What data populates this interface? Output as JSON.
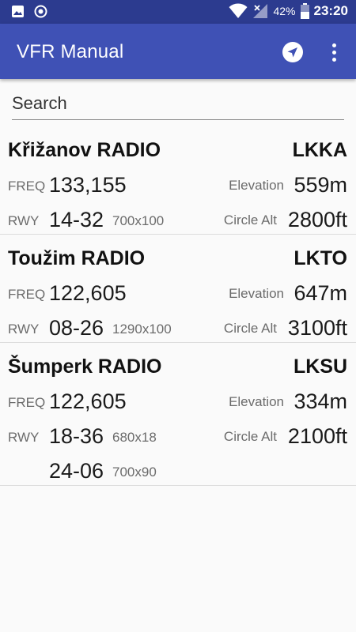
{
  "status_bar": {
    "battery": "42%",
    "time": "23:20"
  },
  "app_bar": {
    "title": "VFR Manual",
    "icons": [
      "navigation-icon",
      "more-vert-icon"
    ]
  },
  "search": {
    "placeholder": "Search"
  },
  "labels": {
    "freq": "FREQ",
    "rwy": "RWY",
    "elevation": "Elevation",
    "circle_alt": "Circle Alt"
  },
  "airports": [
    {
      "name": "Křižanov RADIO",
      "icao": "LKKA",
      "freq": "133,155",
      "elevation": "559m",
      "circle_alt": "2800ft",
      "runways": [
        {
          "designation": "14-32",
          "size": "700x100"
        }
      ]
    },
    {
      "name": "Toužim RADIO",
      "icao": "LKTO",
      "freq": "122,605",
      "elevation": "647m",
      "circle_alt": "3100ft",
      "runways": [
        {
          "designation": "08-26",
          "size": "1290x100"
        }
      ]
    },
    {
      "name": "Šumperk RADIO",
      "icao": "LKSU",
      "freq": "122,605",
      "elevation": "334m",
      "circle_alt": "2100ft",
      "runways": [
        {
          "designation": "18-36",
          "size": "680x18"
        },
        {
          "designation": "24-06",
          "size": "700x90"
        }
      ]
    }
  ]
}
